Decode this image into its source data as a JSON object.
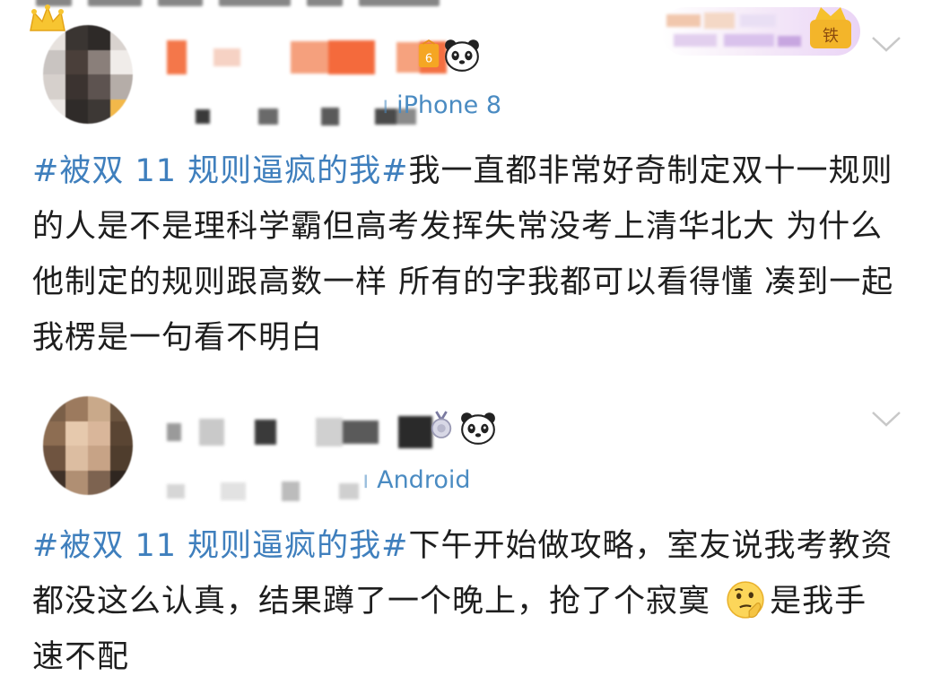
{
  "posts": [
    {
      "source": "iPhone 8",
      "topic": "#被双 11 规则逼疯的我#",
      "body": "我一直都非常好奇制定双十一规则的人是不是理科学霸但高考发挥失常没考上清华北大 为什么他制定的规则跟高数一样 所有的字我都可以看得懂 凑到一起我楞是一句看不明白",
      "badge_text": "铁",
      "icons": [
        "crown-icon",
        "vip-badge-icon",
        "panda-icon",
        "fan-badge-icon",
        "chevron-down-icon"
      ]
    },
    {
      "source": "Android",
      "topic": "#被双 11 规则逼疯的我#",
      "body_before_emoji": "下午开始做攻略，室友说我考教资都没这么认真，结果蹲了一个晚上，抢了个寂寞",
      "body_after_emoji": "是我手速不配",
      "icons": [
        "medal-icon",
        "panda-icon",
        "thinking-emoji-icon",
        "chevron-down-icon"
      ]
    }
  ],
  "colors": {
    "topic": "#3f7fbd",
    "source": "#4a8bc2",
    "text": "#1e1e1e",
    "chevron": "#c8c8c8"
  }
}
